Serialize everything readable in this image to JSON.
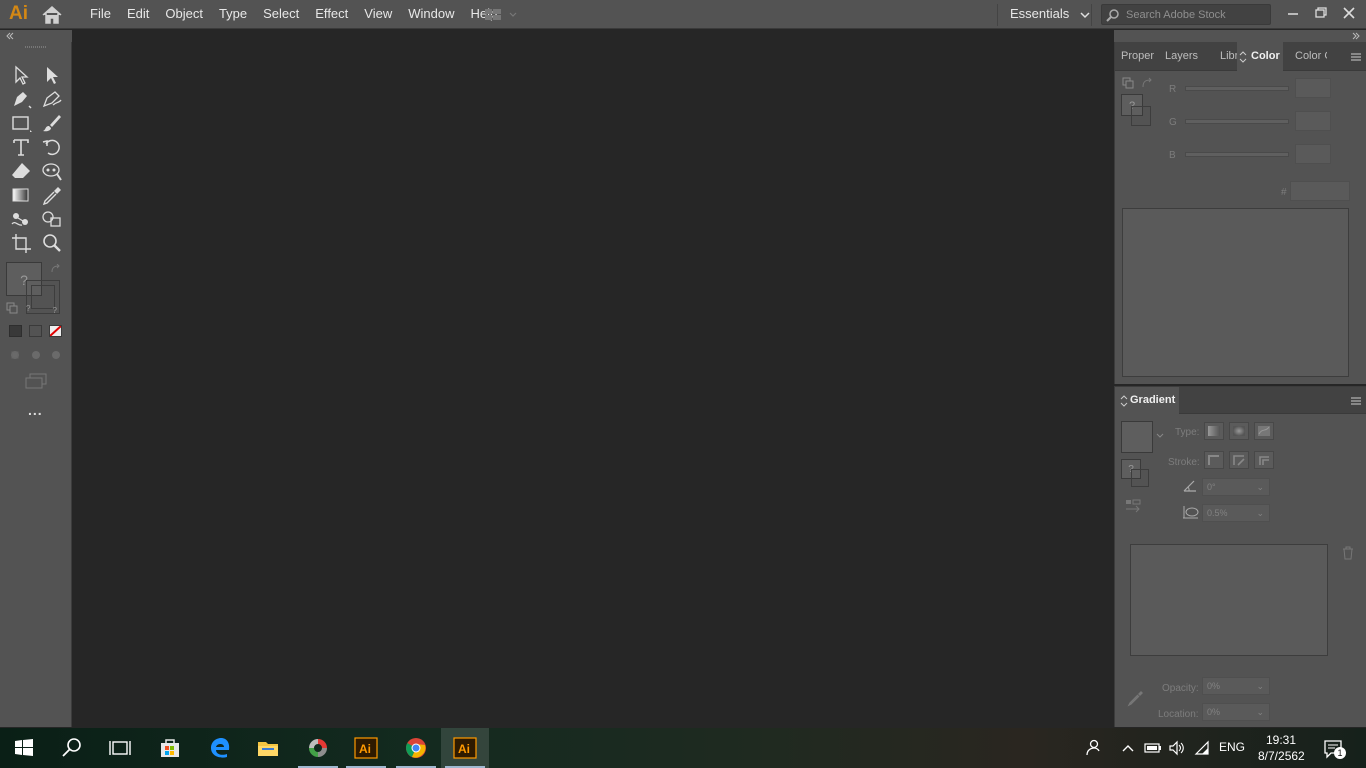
{
  "app": {
    "logo": "Ai",
    "menus": [
      "File",
      "Edit",
      "Object",
      "Type",
      "Select",
      "Effect",
      "View",
      "Window",
      "Help"
    ],
    "workspace": "Essentials",
    "stock_search_placeholder": "Search Adobe Stock",
    "accent_color": "#ff9a00"
  },
  "toolbar": {
    "icons": [
      "selection-icon",
      "direct-selection-icon",
      "pen-icon",
      "curvature-icon",
      "rectangle-icon",
      "paintbrush-icon",
      "type-icon",
      "rotate-icon",
      "eraser-icon",
      "puppet-warp-icon",
      "gradient-icon",
      "eyedropper-icon",
      "blend-icon",
      "shape-builder-icon",
      "artboard-icon",
      "zoom-icon"
    ],
    "fill_unknown": "?",
    "stroke_unknown": "?",
    "more": "..."
  },
  "color_panel": {
    "tabs": [
      "Proper",
      "Layers",
      "Librari",
      "Color",
      "Color G"
    ],
    "active_tab": "Color",
    "channels": [
      "R",
      "G",
      "B"
    ],
    "hex_label": "#",
    "unknown": "?"
  },
  "gradient_panel": {
    "title": "Gradient",
    "type_label": "Type:",
    "stroke_label": "Stroke:",
    "angle_value": "0°",
    "aspect_value": "0.5%",
    "opacity_label": "Opacity:",
    "opacity_value": "0%",
    "location_label": "Location:",
    "location_value": "0%",
    "unknown": "?"
  },
  "taskbar": {
    "apps": [
      "windows-start",
      "search",
      "task-view",
      "microsoft-store",
      "edge",
      "file-explorer",
      "app-wheel",
      "illustrator-pinned",
      "chrome",
      "illustrator-active"
    ],
    "language": "ENG",
    "time": "19:31",
    "date": "8/7/2562",
    "notification_count": "1"
  }
}
